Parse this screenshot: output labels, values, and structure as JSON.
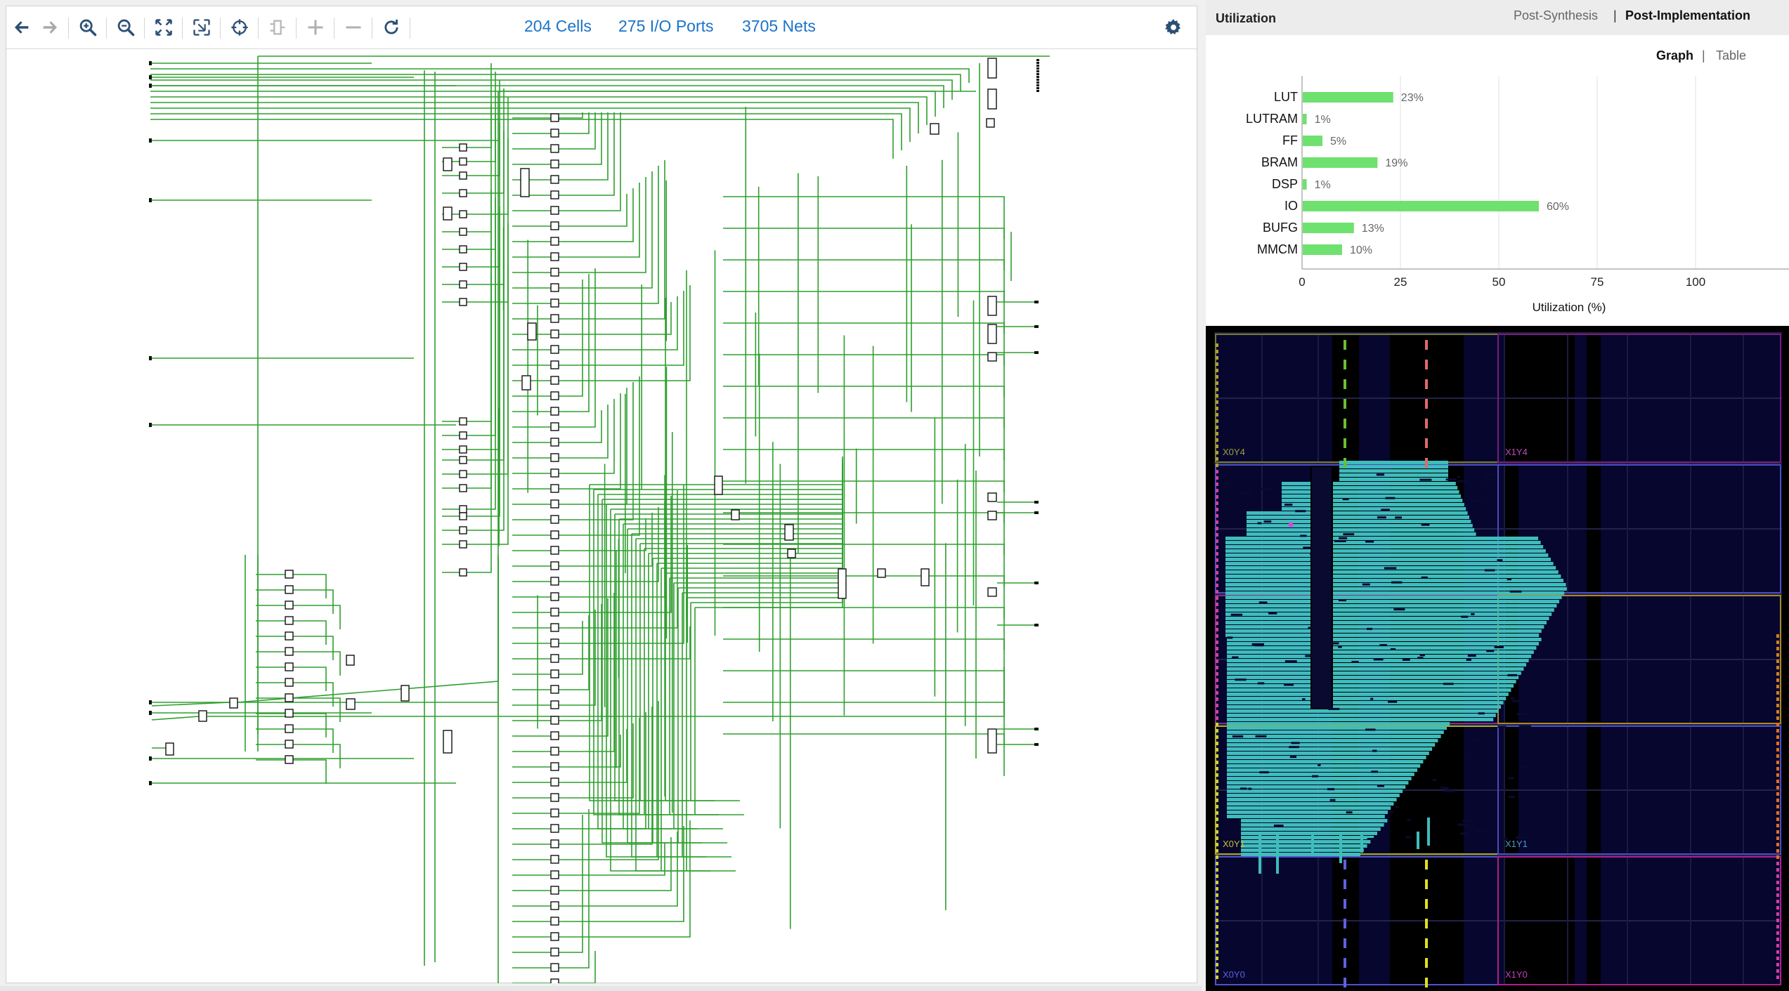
{
  "toolbar": {
    "buttons": [
      {
        "name": "back-button",
        "icon": "arrow-left-icon",
        "enabled": true
      },
      {
        "name": "forward-button",
        "icon": "arrow-right-icon",
        "enabled": false
      },
      {
        "name": "zoom-in-button",
        "icon": "zoom-in-icon",
        "enabled": true
      },
      {
        "name": "zoom-out-button",
        "icon": "zoom-out-icon",
        "enabled": true
      },
      {
        "name": "zoom-fit-button",
        "icon": "fit-icon",
        "enabled": true
      },
      {
        "name": "zoom-area-button",
        "icon": "zoom-area-icon",
        "enabled": true
      },
      {
        "name": "autofit-selection-button",
        "icon": "crosshair-icon",
        "enabled": true
      },
      {
        "name": "regenerate-button",
        "icon": "regenerate-icon",
        "enabled": false
      },
      {
        "name": "expand-button",
        "icon": "plus-icon",
        "enabled": false
      },
      {
        "name": "collapse-button",
        "icon": "minus-icon",
        "enabled": false
      },
      {
        "name": "refresh-button",
        "icon": "refresh-icon",
        "enabled": true
      }
    ],
    "cells": "204 Cells",
    "io_ports": "275 I/O Ports",
    "nets": "3705 Nets",
    "settings_icon": "gear-icon"
  },
  "utilization": {
    "title": "Utilization",
    "tabs": [
      "Post-Synthesis",
      "|",
      "Post-Implementation"
    ],
    "active_tab": "Post-Implementation",
    "view_tabs": [
      "Graph",
      "|",
      "Table"
    ],
    "active_view": "Graph"
  },
  "chart_data": {
    "type": "bar",
    "orientation": "horizontal",
    "categories": [
      "LUT",
      "LUTRAM",
      "FF",
      "BRAM",
      "DSP",
      "IO",
      "BUFG",
      "MMCM"
    ],
    "values": [
      23,
      1,
      5,
      19,
      1,
      60,
      13,
      10
    ],
    "value_labels": [
      "23%",
      "1%",
      "5%",
      "19%",
      "1%",
      "60%",
      "13%",
      "10%"
    ],
    "xlabel": "Utilization (%)",
    "xlim": [
      0,
      125
    ],
    "xticks": [
      0,
      25,
      50,
      75,
      100
    ],
    "grid": true,
    "bar_color": "#6ee16e"
  },
  "device": {
    "clock_regions": [
      "X0Y4",
      "X1Y4",
      "X0Y1",
      "X1Y1",
      "X0Y0",
      "X1Y0"
    ],
    "placement_color": "#3fbcbc",
    "background_color": "#06062e"
  }
}
